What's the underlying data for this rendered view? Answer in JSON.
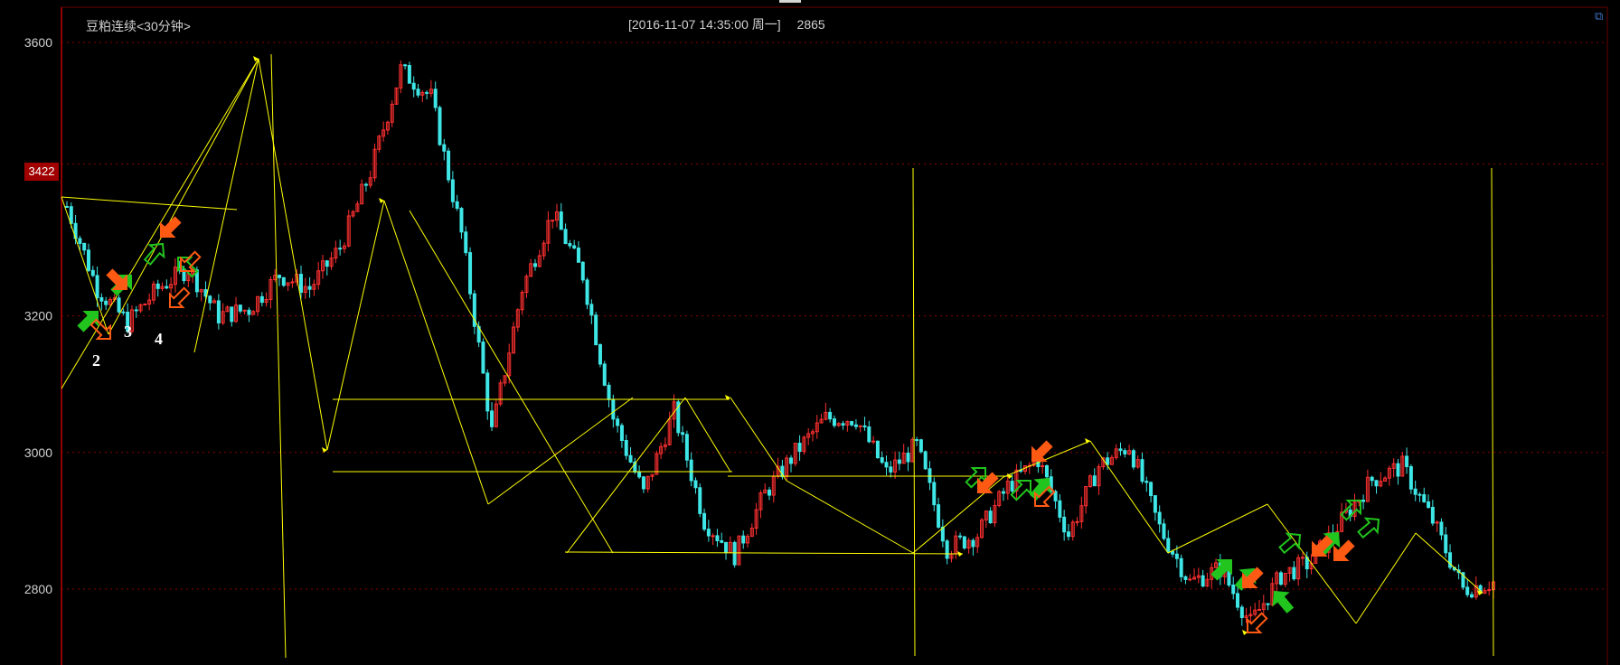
{
  "header": {
    "title": "豆粕连续<30分钟>",
    "info": "[2016-11-07  14:35:00 周一]",
    "last_price": "2865",
    "current_price_badge": "3422"
  },
  "wave_labels": [
    "2",
    "3",
    "4"
  ],
  "colors": {
    "background": "#000000",
    "axis": "#c00000",
    "grid": "#8b0000",
    "candle_up": "#ff3030",
    "candle_down": "#3ee6e6",
    "drawing": "#ffff00",
    "arrow_green": "#22c41e",
    "arrow_orange": "#ff5a14"
  },
  "chart_data": {
    "type": "candlestick",
    "title": "豆粕连续<30分钟>",
    "xlabel": "",
    "ylabel": "",
    "ylim": [
      2700,
      3650
    ],
    "y_ticks": [
      3600,
      3200,
      3000,
      2800
    ],
    "grid": true,
    "series": [
      {
        "approx_path": [
          3360,
          3240,
          3190,
          3240,
          3270,
          3200,
          3210,
          3260,
          3240,
          3300,
          3410,
          3560,
          3520,
          3320,
          3030,
          3240,
          3350,
          3260,
          3050,
          2940,
          3060,
          2900,
          2850,
          2940,
          3000,
          3050,
          3050,
          2970,
          3010,
          2860,
          2880,
          2950,
          2990,
          2880,
          2980,
          3010,
          2890,
          2810,
          2830,
          2750,
          2820,
          2840,
          2900,
          2960,
          2980,
          2900,
          2800,
          2810
        ]
      }
    ],
    "annotations": [
      "3422"
    ]
  }
}
